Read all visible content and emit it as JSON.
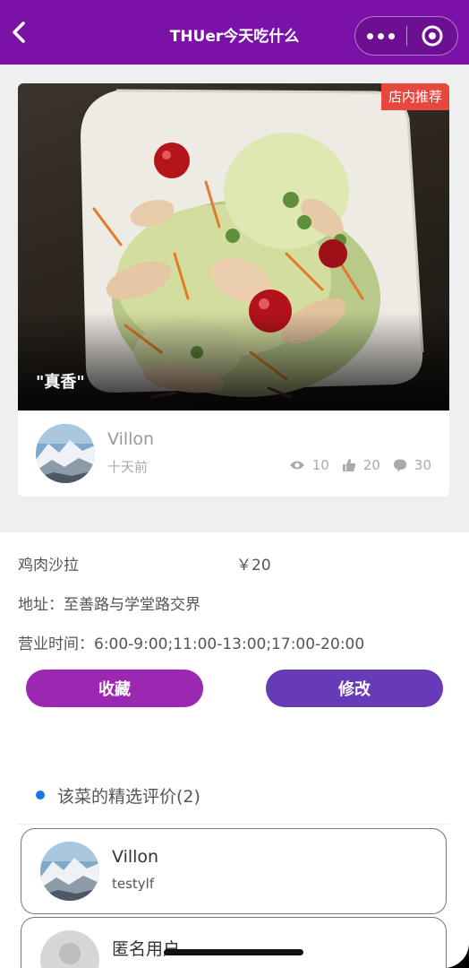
{
  "navbar": {
    "title": "THUer今天吃什么",
    "back_icon": "chevron-left-icon",
    "menu_icon": "more-dots-icon",
    "target_icon": "target-icon",
    "color": "#7b12a8"
  },
  "post": {
    "badge": "店内推荐",
    "badge_color": "#e8473e",
    "caption": "\"真香\"",
    "author": {
      "name": "Villon",
      "time": "十天前"
    },
    "stats": {
      "views": "10",
      "likes": "20",
      "comments": "30"
    }
  },
  "dish": {
    "name": "鸡肉沙拉",
    "price": "￥20",
    "address": "地址：至善路与学堂路交界",
    "hours": "营业时间：6:00-9:00;11:00-13:00;17:00-20:00"
  },
  "actions": {
    "favorite_label": "收藏",
    "edit_label": "修改",
    "favorite_color": "#9c27b0",
    "edit_color": "#673ab7"
  },
  "reviews": {
    "header": "该菜的精选评价(2)",
    "items": [
      {
        "name": "Villon",
        "text": "testylf"
      },
      {
        "name": "匿名用户",
        "text": ""
      }
    ]
  }
}
